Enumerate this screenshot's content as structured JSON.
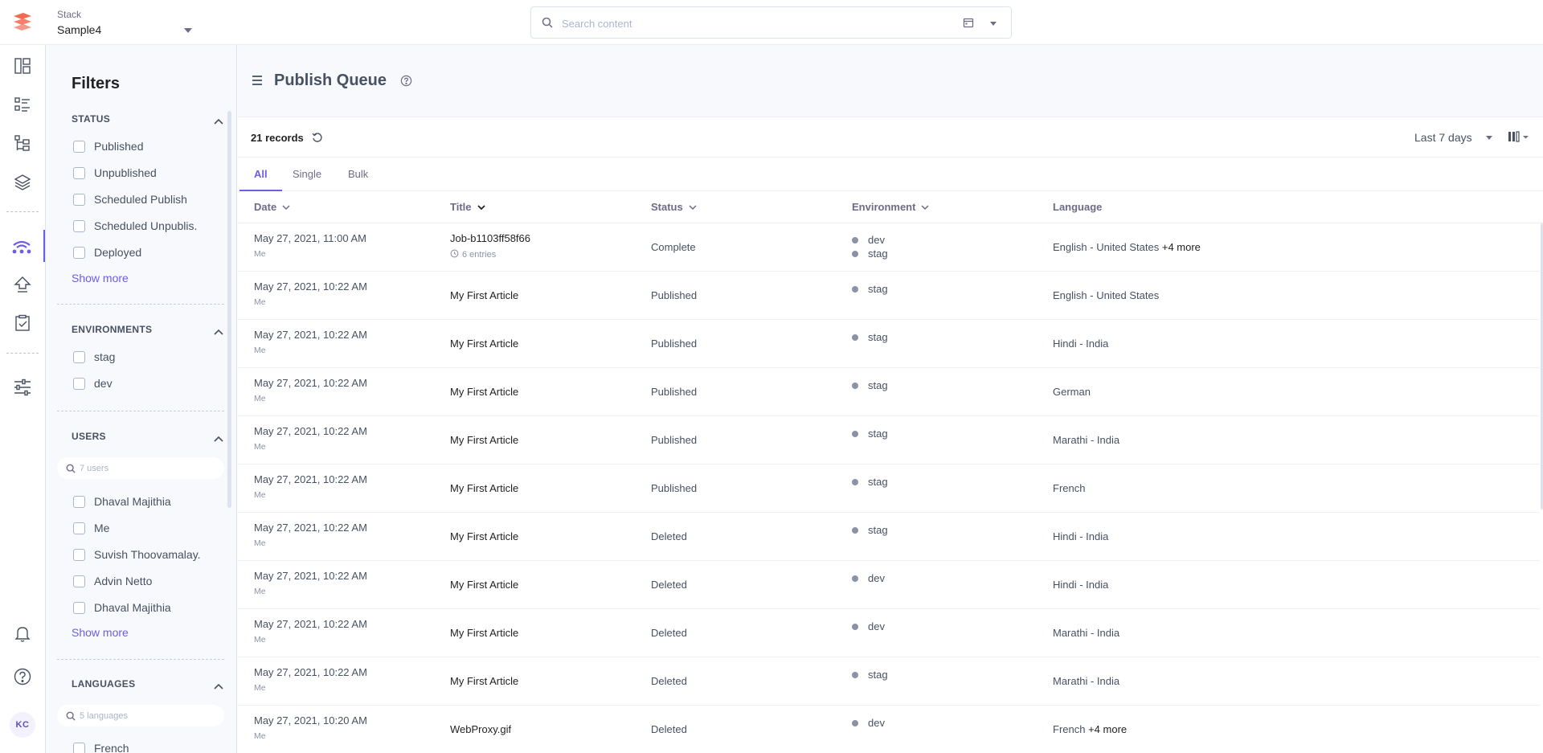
{
  "colors": {
    "accent": "#6c5ce7",
    "brand": "#f06b52",
    "text": "#475161"
  },
  "header": {
    "stack_label": "Stack",
    "stack_name": "Sample4",
    "search_placeholder": "Search content"
  },
  "rail": {
    "items": [
      "dashboard-icon",
      "entries-icon",
      "content-models-icon",
      "assets-icon",
      "publish-queue-icon",
      "releases-icon",
      "tasks-icon",
      "settings-icon"
    ],
    "bottom": [
      "notifications-icon",
      "help-icon"
    ],
    "avatar": "KC"
  },
  "filters": {
    "title": "Filters",
    "status": {
      "title": "STATUS",
      "options": [
        "Published",
        "Unpublished",
        "Scheduled Publish",
        "Scheduled Unpublis.",
        "Deployed"
      ],
      "show_more": "Show more"
    },
    "environments": {
      "title": "ENVIRONMENTS",
      "options": [
        "stag",
        "dev"
      ]
    },
    "users": {
      "title": "USERS",
      "search_placeholder": "7 users",
      "options": [
        "Dhaval Majithia",
        "Me",
        "Suvish Thoovamalay.",
        "Advin Netto",
        "Dhaval Majithia"
      ],
      "show_more": "Show more"
    },
    "languages": {
      "title": "LANGUAGES",
      "search_placeholder": "5 languages",
      "options": [
        "French"
      ]
    }
  },
  "main": {
    "title": "Publish Queue",
    "records": "21 records",
    "range": "Last 7 days",
    "tabs": [
      "All",
      "Single",
      "Bulk"
    ],
    "columns": [
      "Date",
      "Title",
      "Status",
      "Environment",
      "Language"
    ],
    "rows": [
      {
        "date": "May 27, 2021, 11:00 AM",
        "user": "Me",
        "title": "Job-b1103ff58f66",
        "entries": "6 entries",
        "status": "Complete",
        "envs": [
          "dev",
          "stag"
        ],
        "lang": "English - United States",
        "more": "+4 more"
      },
      {
        "date": "May 27, 2021, 10:22 AM",
        "user": "Me",
        "title": "My First Article",
        "entries": "",
        "status": "Published",
        "envs": [
          "stag"
        ],
        "lang": "English - United States",
        "more": ""
      },
      {
        "date": "May 27, 2021, 10:22 AM",
        "user": "Me",
        "title": "My First Article",
        "entries": "",
        "status": "Published",
        "envs": [
          "stag"
        ],
        "lang": "Hindi - India",
        "more": ""
      },
      {
        "date": "May 27, 2021, 10:22 AM",
        "user": "Me",
        "title": "My First Article",
        "entries": "",
        "status": "Published",
        "envs": [
          "stag"
        ],
        "lang": "German",
        "more": ""
      },
      {
        "date": "May 27, 2021, 10:22 AM",
        "user": "Me",
        "title": "My First Article",
        "entries": "",
        "status": "Published",
        "envs": [
          "stag"
        ],
        "lang": "Marathi - India",
        "more": ""
      },
      {
        "date": "May 27, 2021, 10:22 AM",
        "user": "Me",
        "title": "My First Article",
        "entries": "",
        "status": "Published",
        "envs": [
          "stag"
        ],
        "lang": "French",
        "more": ""
      },
      {
        "date": "May 27, 2021, 10:22 AM",
        "user": "Me",
        "title": "My First Article",
        "entries": "",
        "status": "Deleted",
        "envs": [
          "stag"
        ],
        "lang": "Hindi - India",
        "more": ""
      },
      {
        "date": "May 27, 2021, 10:22 AM",
        "user": "Me",
        "title": "My First Article",
        "entries": "",
        "status": "Deleted",
        "envs": [
          "dev"
        ],
        "lang": "Hindi - India",
        "more": ""
      },
      {
        "date": "May 27, 2021, 10:22 AM",
        "user": "Me",
        "title": "My First Article",
        "entries": "",
        "status": "Deleted",
        "envs": [
          "dev"
        ],
        "lang": "Marathi - India",
        "more": ""
      },
      {
        "date": "May 27, 2021, 10:22 AM",
        "user": "Me",
        "title": "My First Article",
        "entries": "",
        "status": "Deleted",
        "envs": [
          "stag"
        ],
        "lang": "Marathi - India",
        "more": ""
      },
      {
        "date": "May 27, 2021, 10:20 AM",
        "user": "Me",
        "title": "WebProxy.gif",
        "entries": "",
        "status": "Deleted",
        "envs": [
          "dev"
        ],
        "lang": "French",
        "more": "+4 more"
      }
    ]
  }
}
